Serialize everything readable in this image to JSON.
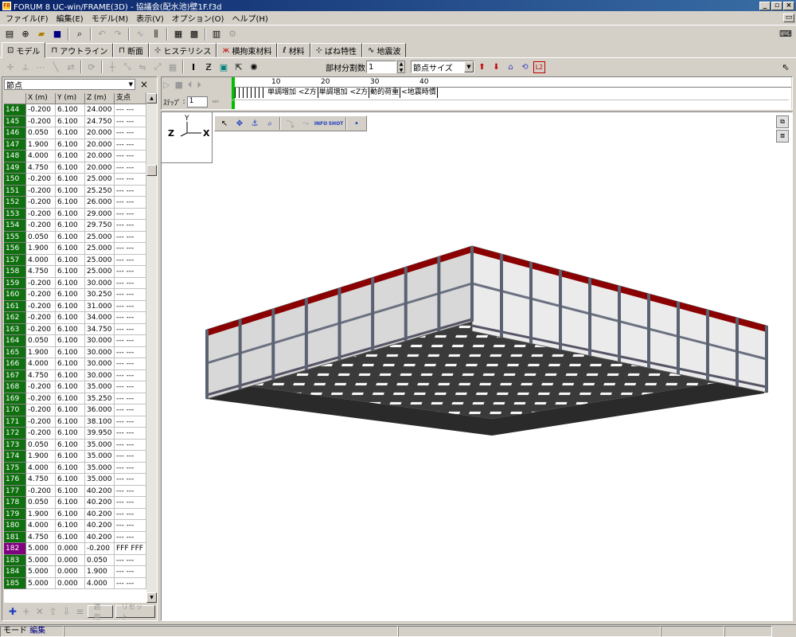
{
  "window": {
    "title": "FORUM 8  UC-win/FRAME(3D) - 協議会(配水池)壁1F.f3d",
    "app_icon": "F8"
  },
  "menu": [
    "ファイル(F)",
    "編集(E)",
    "モデル(M)",
    "表示(V)",
    "オプション(O)",
    "ヘルプ(H)"
  ],
  "tabs": [
    {
      "label": "モデル",
      "icon": "model-icon"
    },
    {
      "label": "アウトライン",
      "icon": "outline-icon"
    },
    {
      "label": "断面",
      "icon": "section-icon"
    },
    {
      "label": "ヒステリシス",
      "icon": "hysteresis-icon"
    },
    {
      "label": "横拘束材料",
      "icon": "confinement-icon"
    },
    {
      "label": "材料",
      "icon": "material-icon"
    },
    {
      "label": "ばね特性",
      "icon": "spring-icon"
    },
    {
      "label": "地震波",
      "icon": "wave-icon"
    }
  ],
  "toolbar2": {
    "divide_label": "部材分割数",
    "divide_value": "1",
    "display_select": "節点サイズ"
  },
  "panel": {
    "selector": "節点",
    "headers": [
      "",
      "X (m)",
      "Y (m)",
      "Z (m)",
      "支点"
    ],
    "rows": [
      [
        "144",
        "-0.200",
        "6.100",
        "24.000",
        "--- ---"
      ],
      [
        "145",
        "-0.200",
        "6.100",
        "24.750",
        "--- ---"
      ],
      [
        "146",
        "0.050",
        "6.100",
        "20.000",
        "--- ---"
      ],
      [
        "147",
        "1.900",
        "6.100",
        "20.000",
        "--- ---"
      ],
      [
        "148",
        "4.000",
        "6.100",
        "20.000",
        "--- ---"
      ],
      [
        "149",
        "4.750",
        "6.100",
        "20.000",
        "--- ---"
      ],
      [
        "150",
        "-0.200",
        "6.100",
        "25.000",
        "--- ---"
      ],
      [
        "151",
        "-0.200",
        "6.100",
        "25.250",
        "--- ---"
      ],
      [
        "152",
        "-0.200",
        "6.100",
        "26.000",
        "--- ---"
      ],
      [
        "153",
        "-0.200",
        "6.100",
        "29.000",
        "--- ---"
      ],
      [
        "154",
        "-0.200",
        "6.100",
        "29.750",
        "--- ---"
      ],
      [
        "155",
        "0.050",
        "6.100",
        "25.000",
        "--- ---"
      ],
      [
        "156",
        "1.900",
        "6.100",
        "25.000",
        "--- ---"
      ],
      [
        "157",
        "4.000",
        "6.100",
        "25.000",
        "--- ---"
      ],
      [
        "158",
        "4.750",
        "6.100",
        "25.000",
        "--- ---"
      ],
      [
        "159",
        "-0.200",
        "6.100",
        "30.000",
        "--- ---"
      ],
      [
        "160",
        "-0.200",
        "6.100",
        "30.250",
        "--- ---"
      ],
      [
        "161",
        "-0.200",
        "6.100",
        "31.000",
        "--- ---"
      ],
      [
        "162",
        "-0.200",
        "6.100",
        "34.000",
        "--- ---"
      ],
      [
        "163",
        "-0.200",
        "6.100",
        "34.750",
        "--- ---"
      ],
      [
        "164",
        "0.050",
        "6.100",
        "30.000",
        "--- ---"
      ],
      [
        "165",
        "1.900",
        "6.100",
        "30.000",
        "--- ---"
      ],
      [
        "166",
        "4.000",
        "6.100",
        "30.000",
        "--- ---"
      ],
      [
        "167",
        "4.750",
        "6.100",
        "30.000",
        "--- ---"
      ],
      [
        "168",
        "-0.200",
        "6.100",
        "35.000",
        "--- ---"
      ],
      [
        "169",
        "-0.200",
        "6.100",
        "35.250",
        "--- ---"
      ],
      [
        "170",
        "-0.200",
        "6.100",
        "36.000",
        "--- ---"
      ],
      [
        "171",
        "-0.200",
        "6.100",
        "38.100",
        "--- ---"
      ],
      [
        "172",
        "-0.200",
        "6.100",
        "39.950",
        "--- ---"
      ],
      [
        "173",
        "0.050",
        "6.100",
        "35.000",
        "--- ---"
      ],
      [
        "174",
        "1.900",
        "6.100",
        "35.000",
        "--- ---"
      ],
      [
        "175",
        "4.000",
        "6.100",
        "35.000",
        "--- ---"
      ],
      [
        "176",
        "4.750",
        "6.100",
        "35.000",
        "--- ---"
      ],
      [
        "177",
        "-0.200",
        "6.100",
        "40.200",
        "--- ---"
      ],
      [
        "178",
        "0.050",
        "6.100",
        "40.200",
        "--- ---"
      ],
      [
        "179",
        "1.900",
        "6.100",
        "40.200",
        "--- ---"
      ],
      [
        "180",
        "4.000",
        "6.100",
        "40.200",
        "--- ---"
      ],
      [
        "181",
        "4.750",
        "6.100",
        "40.200",
        "--- ---"
      ],
      [
        "182",
        "5.000",
        "0.000",
        "-0.200",
        "FFF FFF"
      ],
      [
        "183",
        "5.000",
        "0.000",
        "0.050",
        "--- ---"
      ],
      [
        "184",
        "5.000",
        "0.000",
        "1.900",
        "--- ---"
      ],
      [
        "185",
        "5.000",
        "0.000",
        "4.000",
        "--- ---"
      ]
    ],
    "selected_row": "182",
    "apply_label": "適用",
    "reset_label": "リセット"
  },
  "timeline": {
    "step_label": "ｽﾃｯﾌﾟ",
    "step_value": "1",
    "ruler": [
      "10",
      "20",
      "30",
      "40"
    ],
    "cases": [
      "単調増加 <Z方",
      "単調増加 <Z方",
      "動的荷重",
      "<地震時慣"
    ]
  },
  "viewport": {
    "axis_z": "Z",
    "axis_x": "X",
    "axis_y": "Y",
    "info_label": "INFO",
    "shot_label": "SHOT"
  },
  "status": {
    "mode_label": "モード",
    "mode_value": "編集"
  },
  "colors": {
    "title_bar": "#0a246a",
    "row_header": "#107010",
    "row_selected": "#800080",
    "wall_top": "#8b0000",
    "wall": "#e4e4e4",
    "slab": "#3a3a3a"
  }
}
